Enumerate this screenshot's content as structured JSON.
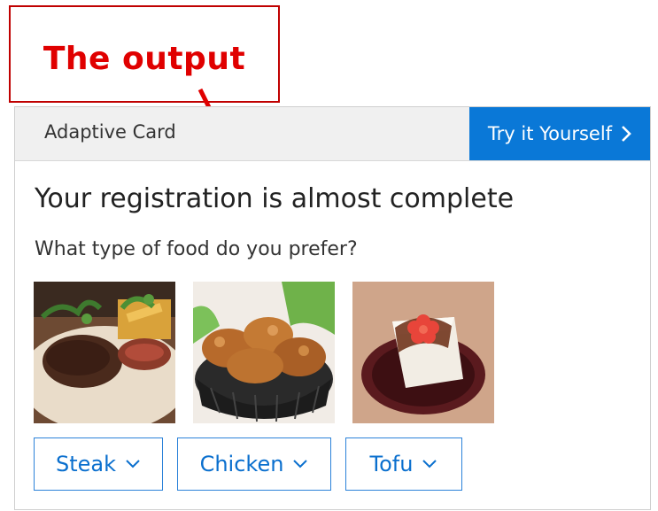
{
  "callout": {
    "label": "The output"
  },
  "card": {
    "header_title": "Adaptive Card",
    "try_button_label": "Try it Yourself",
    "title": "Your registration is almost complete",
    "question": "What type of food do you prefer?",
    "choices": [
      {
        "label": "Steak",
        "image": "steak-image"
      },
      {
        "label": "Chicken",
        "image": "chicken-image"
      },
      {
        "label": "Tofu",
        "image": "tofu-image"
      }
    ]
  },
  "colors": {
    "callout_border": "#c00000",
    "callout_text": "#e00000",
    "accent_blue": "#0a78d7",
    "header_bg": "#f0f0f0"
  }
}
